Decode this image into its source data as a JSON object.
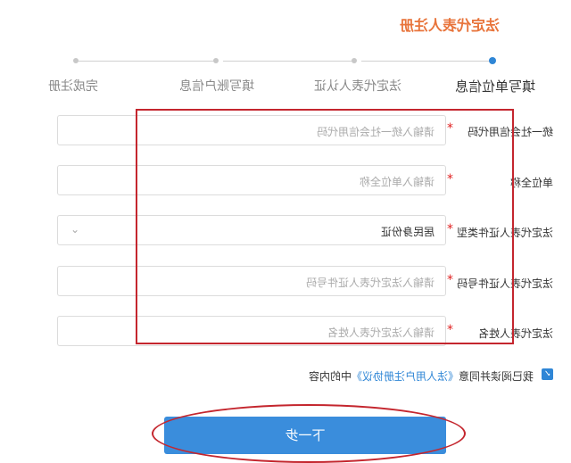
{
  "page": {
    "title": "法定代表人注册"
  },
  "steps": [
    {
      "label": "填写单位信息",
      "active": true
    },
    {
      "label": "法定代表人认证",
      "active": false
    },
    {
      "label": "填写账户信息",
      "active": false
    },
    {
      "label": "完成注册",
      "active": false
    }
  ],
  "form": {
    "fields": [
      {
        "label": "统一社会信用代码",
        "placeholder": "请输入统一社会信用代码",
        "required": true
      },
      {
        "label": "单位全称",
        "placeholder": "请输入单位全称",
        "required": true
      },
      {
        "label": "法定代表人证件类型",
        "value": "居民身份证",
        "required": true,
        "type": "select"
      },
      {
        "label": "法定代表人证件号码",
        "placeholder": "请输入法定代表人证件号码",
        "required": true
      },
      {
        "label": "法定代表人姓名",
        "placeholder": "请输入法定代表人姓名",
        "required": true
      }
    ],
    "required_mark": "*"
  },
  "agreement": {
    "prefix": "我已阅读并同意",
    "link": "《法人用户注册协议》",
    "suffix": "中的内容",
    "checked": true
  },
  "next_button": {
    "label": "下一步"
  },
  "colors": {
    "accent": "#2f86d6",
    "title": "#e8743b",
    "highlight": "#c4262e"
  }
}
